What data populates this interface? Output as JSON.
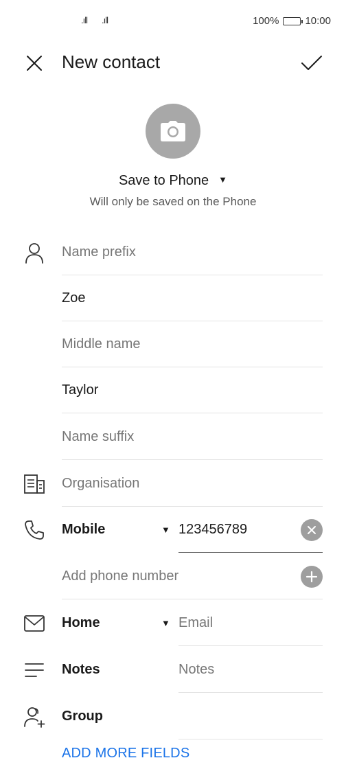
{
  "status_bar": {
    "signal_1": ".ıll",
    "signal_2": ".ıll",
    "battery_pct": "100%",
    "time": "10:00",
    "battery_level": 1.0
  },
  "header": {
    "title": "New contact",
    "close_icon": "close-icon",
    "confirm_icon": "check-icon"
  },
  "avatar": {
    "icon": "camera-icon"
  },
  "save_location": {
    "label": "Save to Phone",
    "caret": "▼",
    "subtitle": "Will only be saved on the Phone"
  },
  "name_fields": {
    "prefix_placeholder": "Name prefix",
    "first_name": "Zoe",
    "middle_placeholder": "Middle name",
    "last_name": "Taylor",
    "suffix_placeholder": "Name suffix"
  },
  "organisation": {
    "placeholder": "Organisation"
  },
  "phone": {
    "type": "Mobile",
    "caret": "▼",
    "value": "123456789",
    "add_placeholder": "Add phone number"
  },
  "email": {
    "type": "Home",
    "caret": "▼",
    "placeholder": "Email"
  },
  "notes": {
    "label": "Notes",
    "placeholder": "Notes"
  },
  "group": {
    "label": "Group"
  },
  "add_more": {
    "label": "ADD MORE FIELDS"
  },
  "colors": {
    "accent": "#1a73e8",
    "avatar_bg": "#a8a8a8",
    "divider": "#e2e2e2",
    "placeholder_text": "#777777"
  }
}
